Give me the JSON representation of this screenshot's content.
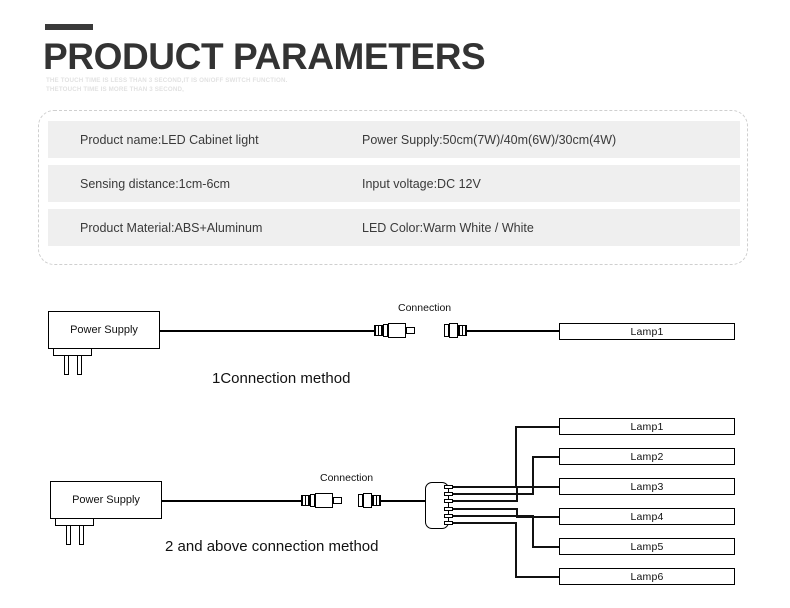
{
  "header": {
    "title": "PRODUCT PARAMETERS",
    "subtitle_line1": "THE TOUCH TIME IS LESS THAN 3 SECOND,IT IS ON/OFF SWITCH FUNCTION.",
    "subtitle_line2": "THETOUCH TIME IS MORE THAN 3 SECOND,",
    "accent_color": "#3a3a3a"
  },
  "spec_table": {
    "row_background": "#efefef",
    "border_color": "#cfcfcf",
    "rows": [
      {
        "left": "Product name:LED Cabinet light",
        "right": "Power Supply:50cm(7W)/40m(6W)/30cm(4W)"
      },
      {
        "left": "Sensing distance:1cm-6cm",
        "right": "Input voltage:DC 12V"
      },
      {
        "left": "Product Material:ABS+Aluminum",
        "right": "LED Color:Warm White / White"
      }
    ]
  },
  "diagram1": {
    "power_supply_label": "Power Supply",
    "connection_label": "Connection",
    "method_label": "1Connection method",
    "lamps": [
      "Lamp1"
    ]
  },
  "diagram2": {
    "power_supply_label": "Power Supply",
    "connection_label": "Connection",
    "method_label": "2 and above connection method",
    "lamps": [
      "Lamp1",
      "Lamp2",
      "Lamp3",
      "Lamp4",
      "Lamp5",
      "Lamp6"
    ]
  }
}
